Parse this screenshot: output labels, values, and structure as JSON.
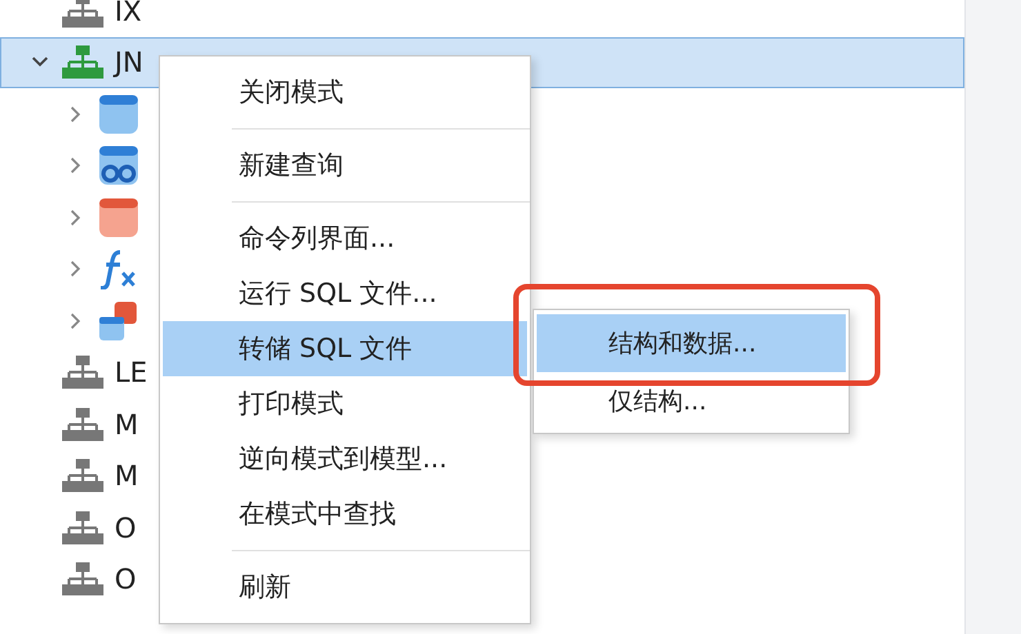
{
  "tree": [
    {
      "label": "IX",
      "kind": "schema",
      "selected": false
    },
    {
      "label": "JN",
      "kind": "schema",
      "selected": true,
      "expanded": true,
      "children": [
        {
          "kind": "table",
          "expanded": false
        },
        {
          "kind": "view",
          "expanded": false
        },
        {
          "kind": "query",
          "expanded": false
        },
        {
          "kind": "function",
          "expanded": false
        },
        {
          "kind": "report",
          "expanded": false
        }
      ]
    },
    {
      "label": "LE",
      "kind": "schema",
      "selected": false
    },
    {
      "label": "M",
      "kind": "schema",
      "selected": false
    },
    {
      "label": "M",
      "kind": "schema",
      "selected": false
    },
    {
      "label": "O",
      "kind": "schema",
      "selected": false
    },
    {
      "label": "O",
      "kind": "schema",
      "selected": false
    }
  ],
  "context_menu": [
    {
      "kind": "item",
      "label": "关闭模式",
      "selected": false
    },
    {
      "kind": "separator"
    },
    {
      "kind": "item",
      "label": "新建查询",
      "selected": false
    },
    {
      "kind": "separator"
    },
    {
      "kind": "item",
      "label": "命令列界面...",
      "selected": false
    },
    {
      "kind": "item",
      "label": "运行 SQL 文件...",
      "selected": false
    },
    {
      "kind": "item",
      "label": "转储 SQL 文件",
      "selected": true
    },
    {
      "kind": "item",
      "label": "打印模式",
      "selected": false
    },
    {
      "kind": "item",
      "label": "逆向模式到模型...",
      "selected": false
    },
    {
      "kind": "item",
      "label": "在模式中查找",
      "selected": false
    },
    {
      "kind": "separator"
    },
    {
      "kind": "item",
      "label": "刷新",
      "selected": false
    }
  ],
  "submenu": [
    {
      "label": "结构和数据...",
      "selected": true
    },
    {
      "label": "仅结构...",
      "selected": false
    }
  ]
}
